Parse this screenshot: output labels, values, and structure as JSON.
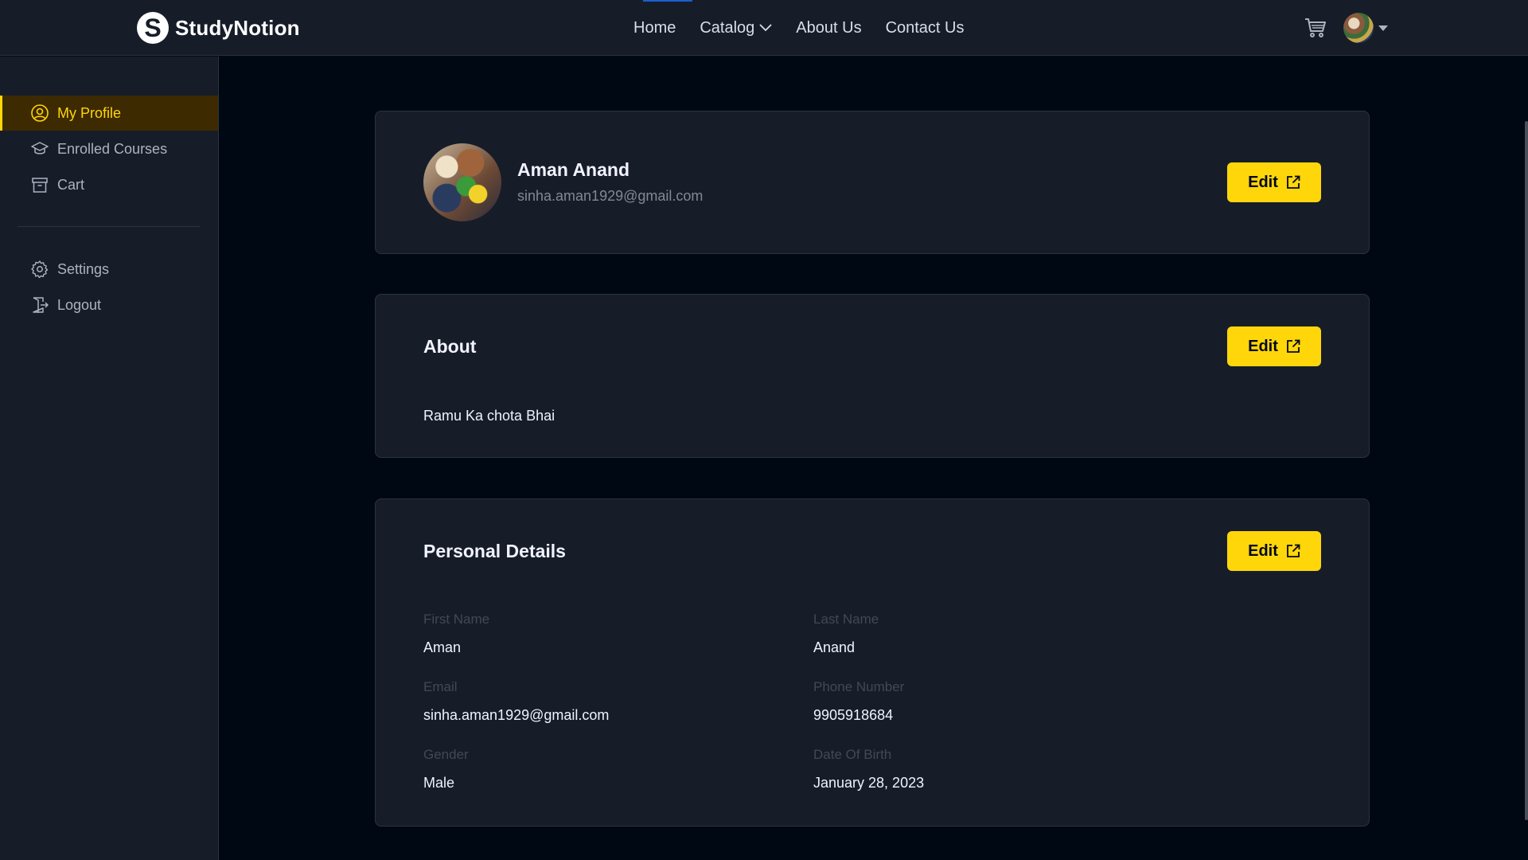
{
  "brand": {
    "name": "StudyNotion",
    "mark": "S"
  },
  "nav": {
    "links": [
      {
        "label": "Home"
      },
      {
        "label": "Catalog"
      },
      {
        "label": "About Us"
      },
      {
        "label": "Contact Us"
      }
    ]
  },
  "sidebar": {
    "items": [
      {
        "label": "My Profile",
        "icon": "user-circle-icon",
        "active": true
      },
      {
        "label": "Enrolled Courses",
        "icon": "graduation-cap-icon"
      },
      {
        "label": "Cart",
        "icon": "archive-box-icon"
      }
    ],
    "bottom_items": [
      {
        "label": "Settings",
        "icon": "gear-icon"
      },
      {
        "label": "Logout",
        "icon": "logout-icon"
      }
    ]
  },
  "profile": {
    "name": "Aman Anand",
    "email": "sinha.aman1929@gmail.com",
    "edit_label": "Edit"
  },
  "about": {
    "title": "About",
    "text": "Ramu Ka chota Bhai",
    "edit_label": "Edit"
  },
  "personal": {
    "title": "Personal Details",
    "edit_label": "Edit",
    "fields": {
      "first_name": {
        "label": "First Name",
        "value": "Aman"
      },
      "last_name": {
        "label": "Last Name",
        "value": "Anand"
      },
      "email": {
        "label": "Email",
        "value": "sinha.aman1929@gmail.com"
      },
      "phone": {
        "label": "Phone Number",
        "value": "9905918684"
      },
      "gender": {
        "label": "Gender",
        "value": "Male"
      },
      "dob": {
        "label": "Date Of Birth",
        "value": "January 28, 2023"
      }
    }
  },
  "colors": {
    "accent": "#FFD60A",
    "background": "#000814",
    "panel": "#161D29",
    "active_bg": "#3D2A01"
  }
}
